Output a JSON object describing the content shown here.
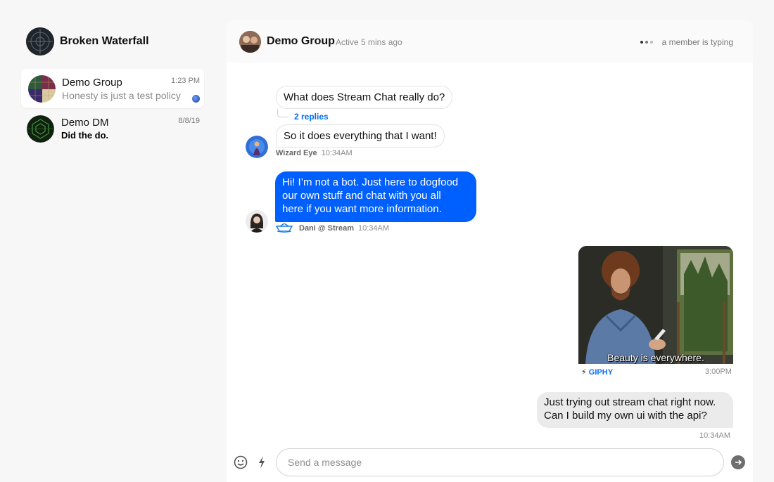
{
  "user": {
    "name": "Broken Waterfall"
  },
  "channels": [
    {
      "name": "Demo Group",
      "preview": "Honesty is just a test policy",
      "time": "1:23 PM",
      "active": true
    },
    {
      "name": "Demo DM",
      "preview": "Did the do.",
      "time": "8/8/19",
      "active": false
    }
  ],
  "header": {
    "title": "Demo Group",
    "status": "Active 5 mins ago",
    "typing": "a member is typing"
  },
  "messages": {
    "m1": {
      "text": "What does Stream Chat really do?",
      "replies": "2 replies"
    },
    "m2": {
      "text": "So it does everything that I want!",
      "author": "Wizard Eye",
      "time": "10:34AM"
    },
    "m3": {
      "lines": [
        "Hi! I’m not a bot. Just here to dogfood",
        "our own stuff and chat with you all",
        "here if you want more information."
      ],
      "author": "Dani @ Stream",
      "time": "10:34AM"
    },
    "gif": {
      "caption": "Beauty is everywhere.",
      "source": "GIPHY",
      "time": "3:00PM"
    },
    "m5": {
      "lines": [
        "Just trying out stream chat right now.",
        "Can I build my own ui with the api?"
      ],
      "time": "10:34AM"
    }
  },
  "composer": {
    "placeholder": "Send a message"
  },
  "colors": {
    "accent": "#005fff",
    "link": "#006cff",
    "panel": "#ffffff",
    "background": "#f7f7f7"
  },
  "icons": [
    "crosshair-avatar-icon",
    "smiley-icon",
    "lightning-bolt-icon",
    "send-arrow-icon",
    "stream-boat-icon"
  ]
}
